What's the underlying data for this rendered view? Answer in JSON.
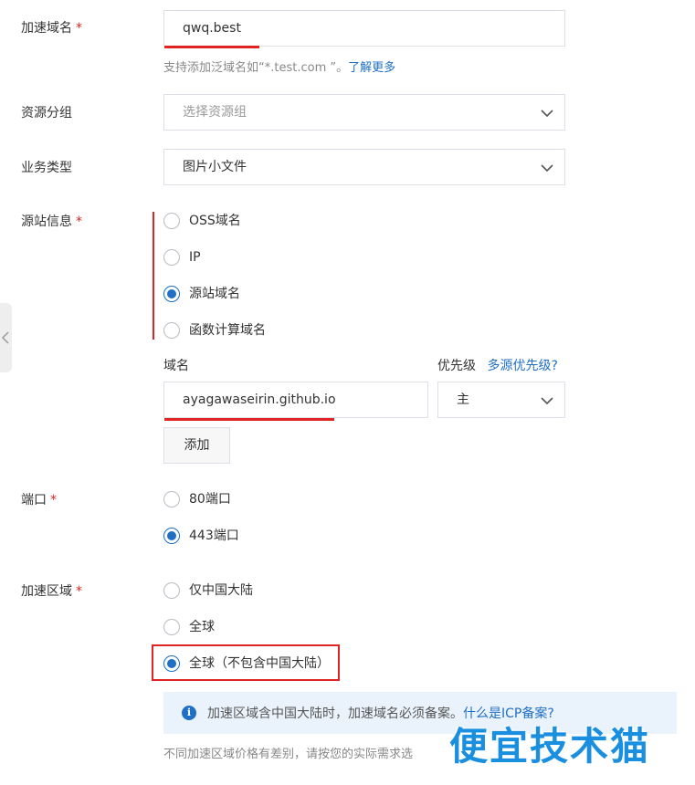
{
  "form": {
    "domain": {
      "label": "加速域名",
      "required_mark": "*",
      "value": "qwq.best",
      "hint_prefix": "支持添加泛域名如“*.test.com ”。",
      "hint_link": "了解更多"
    },
    "resource_group": {
      "label": "资源分组",
      "placeholder": "选择资源组"
    },
    "business_type": {
      "label": "业务类型",
      "value": "图片小文件"
    },
    "origin": {
      "label": "源站信息",
      "required_mark": "*",
      "options": [
        {
          "label": "OSS域名",
          "selected": false
        },
        {
          "label": "IP",
          "selected": false
        },
        {
          "label": "源站域名",
          "selected": true
        },
        {
          "label": "函数计算域名",
          "selected": false
        }
      ],
      "domain_column_label": "域名",
      "priority_column_label": "优先级",
      "priority_help_link": "多源优先级?",
      "domain_value": "ayagawaseirin.github.io",
      "priority_value": "主",
      "add_button": "添加"
    },
    "port": {
      "label": "端口",
      "required_mark": "*",
      "options": [
        {
          "label": "80端口",
          "selected": false
        },
        {
          "label": "443端口",
          "selected": true
        }
      ]
    },
    "region": {
      "label": "加速区域",
      "required_mark": "*",
      "options": [
        {
          "label": "仅中国大陆",
          "selected": false
        },
        {
          "label": "全球",
          "selected": false
        },
        {
          "label": "全球（不包含中国大陆）",
          "selected": true
        }
      ],
      "info_text": "加速区域含中国大陆时，加速域名必须备案。",
      "info_link": "什么是ICP备案?",
      "price_hint": "不同加速区域价格有差别，请按您的实际需求选"
    }
  },
  "watermark": "便宜技术猫",
  "colors": {
    "accent": "#1f6fc5",
    "highlight_red": "#e02424",
    "info_bg": "#eaf3fc"
  }
}
